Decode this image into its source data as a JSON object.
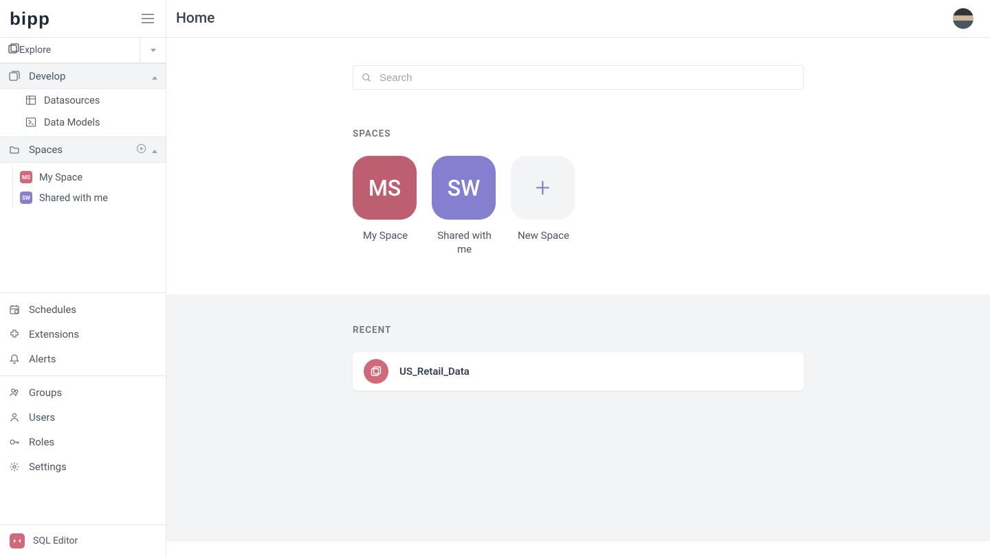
{
  "app": {
    "logo_text": "bipp"
  },
  "header": {
    "title": "Home"
  },
  "sidebar": {
    "explore_label": "Explore",
    "develop_label": "Develop",
    "develop_items": [
      {
        "label": "Datasources"
      },
      {
        "label": "Data Models"
      }
    ],
    "spaces_label": "Spaces",
    "space_items": [
      {
        "badge": "MS",
        "label": "My Space",
        "color": "pink"
      },
      {
        "badge": "SW",
        "label": "Shared with me",
        "color": "purple"
      }
    ],
    "ops_items": [
      {
        "label": "Schedules"
      },
      {
        "label": "Extensions"
      },
      {
        "label": "Alerts"
      }
    ],
    "admin_items": [
      {
        "label": "Groups"
      },
      {
        "label": "Users"
      },
      {
        "label": "Roles"
      },
      {
        "label": "Settings"
      }
    ],
    "sql_editor_label": "SQL Editor"
  },
  "search": {
    "placeholder": "Search"
  },
  "spaces_section": {
    "heading": "SPACES",
    "cards": [
      {
        "tile_text": "MS",
        "label": "My Space",
        "color": "pink"
      },
      {
        "tile_text": "SW",
        "label": "Shared with me",
        "color": "purple"
      }
    ],
    "new_space_label": "New Space"
  },
  "recent_section": {
    "heading": "RECENT",
    "items": [
      {
        "title": "US_Retail_Data"
      }
    ]
  }
}
